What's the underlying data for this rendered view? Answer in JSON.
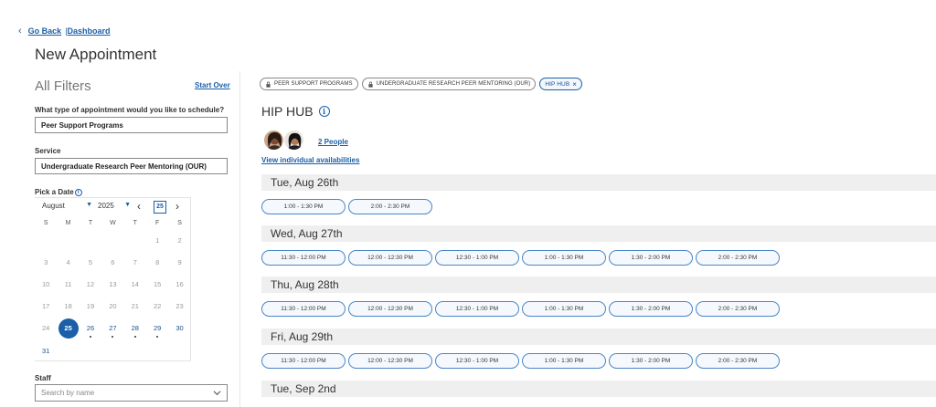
{
  "nav": {
    "go_back": "Go Back",
    "separator": "|",
    "dashboard": "Dashboard"
  },
  "page_title": "New Appointment",
  "filters": {
    "title": "All Filters",
    "start_over": "Start Over",
    "appointment_type_label": "What type of appointment would you like to schedule?",
    "appointment_type_value": "Peer Support Programs",
    "service_label": "Service",
    "service_value": "Undergraduate Research Peer Mentoring (OUR)",
    "pick_date_label": "Pick a Date",
    "staff_label": "Staff",
    "staff_placeholder": "Search by name"
  },
  "calendar": {
    "month": "August",
    "year": "2025",
    "today_button": "25",
    "weekdays": [
      "S",
      "M",
      "T",
      "W",
      "T",
      "F",
      "S"
    ],
    "days": [
      {
        "n": "",
        "s": "blank"
      },
      {
        "n": "",
        "s": "blank"
      },
      {
        "n": "",
        "s": "blank"
      },
      {
        "n": "",
        "s": "blank"
      },
      {
        "n": "",
        "s": "blank"
      },
      {
        "n": "1",
        "s": "off"
      },
      {
        "n": "2",
        "s": "off"
      },
      {
        "n": "3",
        "s": "off"
      },
      {
        "n": "4",
        "s": "off"
      },
      {
        "n": "5",
        "s": "off"
      },
      {
        "n": "6",
        "s": "off"
      },
      {
        "n": "7",
        "s": "off"
      },
      {
        "n": "8",
        "s": "off"
      },
      {
        "n": "9",
        "s": "off"
      },
      {
        "n": "10",
        "s": "off"
      },
      {
        "n": "11",
        "s": "off"
      },
      {
        "n": "12",
        "s": "off"
      },
      {
        "n": "13",
        "s": "off"
      },
      {
        "n": "14",
        "s": "off"
      },
      {
        "n": "15",
        "s": "off"
      },
      {
        "n": "16",
        "s": "off"
      },
      {
        "n": "17",
        "s": "off"
      },
      {
        "n": "18",
        "s": "off"
      },
      {
        "n": "19",
        "s": "off"
      },
      {
        "n": "20",
        "s": "off"
      },
      {
        "n": "21",
        "s": "off"
      },
      {
        "n": "22",
        "s": "off"
      },
      {
        "n": "23",
        "s": "off"
      },
      {
        "n": "24",
        "s": "off"
      },
      {
        "n": "25",
        "s": "selected"
      },
      {
        "n": "26",
        "s": "avail"
      },
      {
        "n": "27",
        "s": "avail"
      },
      {
        "n": "28",
        "s": "avail"
      },
      {
        "n": "29",
        "s": "avail"
      },
      {
        "n": "30",
        "s": "plain"
      },
      {
        "n": "31",
        "s": "plain"
      }
    ]
  },
  "chips": [
    {
      "label": "Peer Support Programs",
      "locked": true
    },
    {
      "label": "Undergraduate Research Peer Mentoring (OUR)",
      "locked": true
    },
    {
      "label": "HIP HUB",
      "locked": false
    }
  ],
  "group": {
    "title": "HIP HUB",
    "people_link": "2 People",
    "availability_link": "View individual availabilities"
  },
  "days": [
    {
      "label": "Tue, Aug 26th",
      "slots": [
        "1:00 - 1:30 PM",
        "2:00 - 2:30 PM"
      ]
    },
    {
      "label": "Wed, Aug 27th",
      "slots": [
        "11:30 - 12:00 PM",
        "12:00 - 12:30 PM",
        "12:30 - 1:00 PM",
        "1:00 - 1:30 PM",
        "1:30 - 2:00 PM",
        "2:00 - 2:30 PM"
      ]
    },
    {
      "label": "Thu, Aug 28th",
      "slots": [
        "11:30 - 12:00 PM",
        "12:00 - 12:30 PM",
        "12:30 - 1:00 PM",
        "1:00 - 1:30 PM",
        "1:30 - 2:00 PM",
        "2:00 - 2:30 PM"
      ]
    },
    {
      "label": "Fri, Aug 29th",
      "slots": [
        "11:30 - 12:00 PM",
        "12:00 - 12:30 PM",
        "12:30 - 1:00 PM",
        "1:00 - 1:30 PM",
        "1:30 - 2:00 PM",
        "2:00 - 2:30 PM"
      ]
    },
    {
      "label": "Tue, Sep 2nd",
      "slots": []
    }
  ],
  "colors": {
    "accent": "#1a5fa8",
    "day_bar": "#efefef"
  }
}
